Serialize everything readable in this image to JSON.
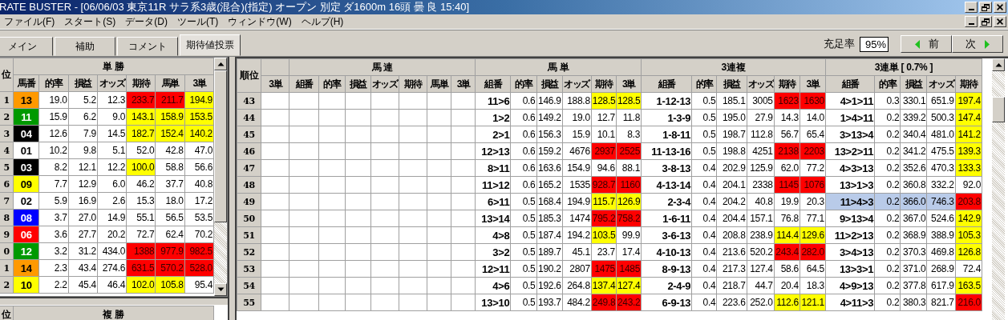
{
  "window": {
    "title": "RATE BUSTER - [06/06/03 東京11R サラ系3歳(混合)(指定) オープン 別定 ダ1600m  16頭 曇 良 15:40]"
  },
  "menu": [
    "ファイル(F)",
    "スタート(S)",
    "データ(D)",
    "ツール(T)",
    "ウィンドウ(W)",
    "ヘルプ(H)"
  ],
  "tabs": [
    {
      "label": "メイン",
      "selected": false
    },
    {
      "label": "補助",
      "selected": false
    },
    {
      "label": "コメント",
      "selected": false
    },
    {
      "label": "期待値投票",
      "selected": true
    }
  ],
  "fill_rate": {
    "label": "充足率",
    "value": "95%"
  },
  "nav_buttons": [
    {
      "label": "前",
      "kind": "prev"
    },
    {
      "label": "次",
      "kind": "next"
    }
  ],
  "win_table": {
    "title": "単 勝",
    "rank_header": "位",
    "horse_header": "馬番",
    "columns": [
      "的率",
      "損益",
      "オッズ",
      "期待",
      "馬単",
      "3単"
    ],
    "rows": [
      {
        "rank": "1",
        "horse": "13",
        "color": "#ff9900",
        "cells": [
          "19.0",
          "5.2",
          "12.3",
          {
            "v": "233.7",
            "color": "#ff0000"
          },
          {
            "v": "211.7",
            "color": "#ff0000"
          },
          {
            "v": "194.9",
            "color": "#ffff00"
          }
        ]
      },
      {
        "rank": "2",
        "horse": "11",
        "color": "#009900",
        "cells": [
          "15.9",
          "6.2",
          "9.0",
          {
            "v": "143.1",
            "color": "#ffff00"
          },
          {
            "v": "158.9",
            "color": "#ffff00"
          },
          {
            "v": "153.5",
            "color": "#ffff00"
          }
        ]
      },
      {
        "rank": "3",
        "horse": "04",
        "color": "#000000",
        "cells": [
          "12.6",
          "7.9",
          "14.5",
          {
            "v": "182.7",
            "color": "#ffff00"
          },
          {
            "v": "152.4",
            "color": "#ffff00"
          },
          {
            "v": "140.2",
            "color": "#ffff00"
          }
        ]
      },
      {
        "rank": "4",
        "horse": "01",
        "color": "#ffffff",
        "cells": [
          "10.2",
          "9.8",
          "5.1",
          "52.0",
          "42.8",
          "47.0"
        ]
      },
      {
        "rank": "5",
        "horse": "03",
        "color": "#000000",
        "cells": [
          "8.2",
          "12.1",
          "12.2",
          {
            "v": "100.0",
            "color": "#ffff00"
          },
          "58.8",
          "56.6"
        ]
      },
      {
        "rank": "6",
        "horse": "09",
        "color": "#ffff00",
        "cells": [
          "7.7",
          "12.9",
          "6.0",
          "46.2",
          "37.7",
          "40.8"
        ]
      },
      {
        "rank": "7",
        "horse": "02",
        "color": "#ffffff",
        "cells": [
          "5.9",
          "16.9",
          "2.6",
          "15.3",
          "18.0",
          "17.2"
        ]
      },
      {
        "rank": "8",
        "horse": "08",
        "color": "#0000ff",
        "cells": [
          "3.7",
          "27.0",
          "14.9",
          "55.1",
          "56.5",
          "53.5"
        ]
      },
      {
        "rank": "9",
        "horse": "06",
        "color": "#ff0000",
        "cells": [
          "3.6",
          "27.7",
          "20.2",
          "72.7",
          "62.4",
          "70.2"
        ]
      },
      {
        "rank": "0",
        "horse": "12",
        "color": "#009900",
        "cells": [
          "3.2",
          "31.2",
          "434.0",
          {
            "v": "1388",
            "color": "#ff0000"
          },
          {
            "v": "977.9",
            "color": "#ff0000"
          },
          {
            "v": "982.5",
            "color": "#ff0000"
          }
        ]
      },
      {
        "rank": "1",
        "horse": "14",
        "color": "#ff9900",
        "cells": [
          "2.3",
          "43.4",
          "274.6",
          {
            "v": "631.5",
            "color": "#ff0000"
          },
          {
            "v": "570.2",
            "color": "#ff0000"
          },
          {
            "v": "528.0",
            "color": "#ff0000"
          }
        ]
      },
      {
        "rank": "2",
        "horse": "10",
        "color": "#ffff00",
        "cells": [
          "2.2",
          "45.4",
          "46.4",
          {
            "v": "102.0",
            "color": "#ffff00"
          },
          {
            "v": "105.8",
            "color": "#ffff00"
          },
          "95.4"
        ]
      }
    ]
  },
  "place_table": {
    "title": "複 勝",
    "rank_header": "位"
  },
  "main_table": {
    "rank_header": "順位",
    "groups": [
      {
        "columns": [
          "3単"
        ]
      },
      {
        "title": "馬 連",
        "columns": [
          "組番",
          "的率",
          "損益",
          "オッズ",
          "期待",
          "馬単",
          "3単"
        ]
      },
      {
        "title": "馬 単",
        "columns": [
          "組番",
          "的率",
          "損益",
          "オッズ",
          "期待",
          "3単"
        ]
      },
      {
        "title": "3連複",
        "columns": [
          "組番",
          "的率",
          "損益",
          "オッズ",
          "期待",
          "3単"
        ]
      },
      {
        "title": "3連単 [ 0.7% ]",
        "columns": [
          "組番",
          "的率",
          "損益",
          "オッズ",
          "期待"
        ]
      }
    ],
    "rows": [
      {
        "rank": "43",
        "selected": false,
        "cells": [
          "11>6",
          "0.6",
          "146.9",
          "188.8",
          {
            "v": "128.5",
            "color": "#ffff00"
          },
          {
            "v": "128.5",
            "color": "#ffff00"
          },
          "1-12-13",
          "0.5",
          "185.1",
          "3005",
          {
            "v": "1623",
            "color": "#ff0000"
          },
          {
            "v": "1630",
            "color": "#ff0000"
          },
          "4>1>11",
          "0.3",
          "330.1",
          "651.9",
          {
            "v": "197.4",
            "color": "#ffff00"
          }
        ]
      },
      {
        "rank": "44",
        "selected": false,
        "cells": [
          "1>2",
          "0.6",
          "149.2",
          "19.0",
          "12.7",
          "11.8",
          "1-3-9",
          "0.5",
          "195.0",
          "27.9",
          "14.3",
          "14.0",
          "1>4>11",
          "0.2",
          "339.2",
          "500.3",
          {
            "v": "147.4",
            "color": "#ffff00"
          }
        ]
      },
      {
        "rank": "45",
        "selected": false,
        "cells": [
          "2>1",
          "0.6",
          "156.3",
          "15.9",
          "10.1",
          "8.3",
          "1-8-11",
          "0.5",
          "198.7",
          "112.8",
          "56.7",
          "65.4",
          "3>13>4",
          "0.2",
          "340.4",
          "481.0",
          {
            "v": "141.2",
            "color": "#ffff00"
          }
        ]
      },
      {
        "rank": "46",
        "selected": false,
        "cells": [
          "12>13",
          "0.6",
          "159.2",
          "4676",
          {
            "v": "2937",
            "color": "#ff0000"
          },
          {
            "v": "2525",
            "color": "#ff0000"
          },
          "11-13-16",
          "0.5",
          "198.8",
          "4251",
          {
            "v": "2138",
            "color": "#ff0000"
          },
          {
            "v": "2203",
            "color": "#ff0000"
          },
          "13>2>11",
          "0.2",
          "341.2",
          "475.5",
          {
            "v": "139.3",
            "color": "#ffff00"
          }
        ]
      },
      {
        "rank": "47",
        "selected": false,
        "cells": [
          "8>11",
          "0.6",
          "163.6",
          "154.9",
          "94.6",
          "88.1",
          "3-8-13",
          "0.4",
          "202.9",
          "125.9",
          "62.0",
          "77.2",
          "4>3>13",
          "0.2",
          "352.6",
          "470.3",
          {
            "v": "133.3",
            "color": "#ffff00"
          }
        ]
      },
      {
        "rank": "48",
        "selected": false,
        "cells": [
          "11>12",
          "0.6",
          "165.2",
          "1535",
          {
            "v": "928.7",
            "color": "#ff0000"
          },
          {
            "v": "1160",
            "color": "#ff0000"
          },
          "4-13-14",
          "0.4",
          "204.1",
          "2338",
          {
            "v": "1145",
            "color": "#ff0000"
          },
          {
            "v": "1076",
            "color": "#ff0000"
          },
          "13>1>3",
          "0.2",
          "360.8",
          "332.2",
          "92.0"
        ]
      },
      {
        "rank": "49",
        "selected": true,
        "cells": [
          "6>11",
          "0.5",
          "168.4",
          "194.9",
          {
            "v": "115.7",
            "color": "#ffff00"
          },
          {
            "v": "126.9",
            "color": "#ffff00"
          },
          "2-3-4",
          "0.4",
          "204.2",
          "40.8",
          "19.9",
          "20.3",
          "11>4>3",
          "0.2",
          "366.0",
          "746.3",
          {
            "v": "203.8",
            "color": "#ff0000"
          }
        ]
      },
      {
        "rank": "50",
        "selected": false,
        "cells": [
          "13>14",
          "0.5",
          "185.3",
          "1474",
          {
            "v": "795.2",
            "color": "#ff0000"
          },
          {
            "v": "758.2",
            "color": "#ff0000"
          },
          "1-6-11",
          "0.4",
          "204.4",
          "157.1",
          "76.8",
          "77.1",
          "9>13>4",
          "0.2",
          "367.0",
          "524.6",
          {
            "v": "142.9",
            "color": "#ffff00"
          }
        ]
      },
      {
        "rank": "51",
        "selected": false,
        "cells": [
          "4>8",
          "0.5",
          "187.4",
          "194.2",
          {
            "v": "103.5",
            "color": "#ffff00"
          },
          "99.9",
          "3-6-13",
          "0.4",
          "208.8",
          "238.9",
          {
            "v": "114.4",
            "color": "#ffff00"
          },
          {
            "v": "129.6",
            "color": "#ffff00"
          },
          "11>2>13",
          "0.2",
          "368.9",
          "388.9",
          {
            "v": "105.3",
            "color": "#ffff00"
          }
        ]
      },
      {
        "rank": "52",
        "selected": false,
        "cells": [
          "3>2",
          "0.5",
          "189.7",
          "45.1",
          "23.7",
          "17.4",
          "4-10-13",
          "0.4",
          "213.6",
          "520.2",
          {
            "v": "243.4",
            "color": "#ff0000"
          },
          {
            "v": "282.0",
            "color": "#ff0000"
          },
          "3>4>13",
          "0.2",
          "370.3",
          "469.8",
          {
            "v": "126.8",
            "color": "#ffff00"
          }
        ]
      },
      {
        "rank": "53",
        "selected": false,
        "cells": [
          "12>11",
          "0.5",
          "190.2",
          "2807",
          {
            "v": "1475",
            "color": "#ff0000"
          },
          {
            "v": "1485",
            "color": "#ff0000"
          },
          "8-9-13",
          "0.4",
          "217.3",
          "127.4",
          "58.6",
          "64.5",
          "13>3>1",
          "0.2",
          "371.0",
          "268.9",
          "72.4"
        ]
      },
      {
        "rank": "54",
        "selected": false,
        "cells": [
          "4>6",
          "0.5",
          "192.6",
          "264.8",
          {
            "v": "137.4",
            "color": "#ffff00"
          },
          {
            "v": "127.4",
            "color": "#ffff00"
          },
          "2-4-9",
          "0.4",
          "218.7",
          "44.7",
          "20.4",
          "18.3",
          "4>9>13",
          "0.2",
          "377.8",
          "617.9",
          {
            "v": "163.5",
            "color": "#ffff00"
          }
        ]
      },
      {
        "rank": "55",
        "selected": false,
        "cells": [
          "13>10",
          "0.5",
          "193.7",
          "484.2",
          {
            "v": "249.8",
            "color": "#ff0000"
          },
          {
            "v": "243.2",
            "color": "#ff0000"
          },
          "6-9-13",
          "0.4",
          "223.6",
          "252.0",
          {
            "v": "112.6",
            "color": "#ffff00"
          },
          {
            "v": "121.1",
            "color": "#ffff00"
          },
          "4>11>3",
          "0.2",
          "380.3",
          "821.7",
          {
            "v": "216.0",
            "color": "#ff0000"
          }
        ]
      }
    ]
  }
}
